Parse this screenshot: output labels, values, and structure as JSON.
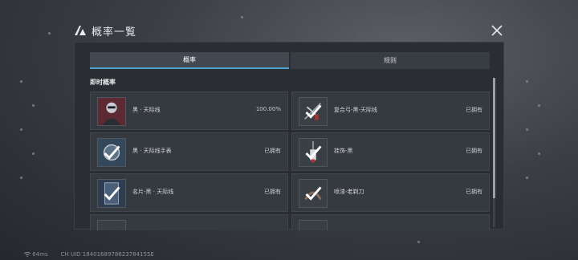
{
  "header": {
    "title": "概率一覧"
  },
  "tabs": [
    {
      "label": "概率",
      "active": true
    },
    {
      "label": "规则",
      "active": false
    }
  ],
  "section": {
    "title": "即时概率"
  },
  "items": [
    {
      "name": "黑 · 天际线",
      "status": "100.00%",
      "icon": "black-skyline-character-icon",
      "owned": false
    },
    {
      "name": "复合弓-黑-天际线",
      "status": "已拥有",
      "icon": "compound-bow-icon",
      "owned": true
    },
    {
      "name": "黑 · 天际线手表",
      "status": "已拥有",
      "icon": "watch-icon",
      "owned": true
    },
    {
      "name": "挂饰-黑",
      "status": "已拥有",
      "icon": "pendant-icon",
      "owned": true
    },
    {
      "name": "名片-黑 · 天际线",
      "status": "已拥有",
      "icon": "name-card-icon",
      "owned": true
    },
    {
      "name": "喷漆-老剃刀",
      "status": "已拥有",
      "icon": "spray-paint-icon",
      "owned": true
    },
    {
      "name": "",
      "status": "",
      "icon": "partial-item-icon",
      "owned": false
    },
    {
      "name": "",
      "status": "",
      "icon": "partial-item-icon",
      "owned": false
    }
  ],
  "footer": {
    "ping": "64ms",
    "uid": "CH UID 1840168978623784155E"
  },
  "colors": {
    "accent": "#4aa3c9",
    "panel": "#2a2e33",
    "card": "#353a40"
  }
}
